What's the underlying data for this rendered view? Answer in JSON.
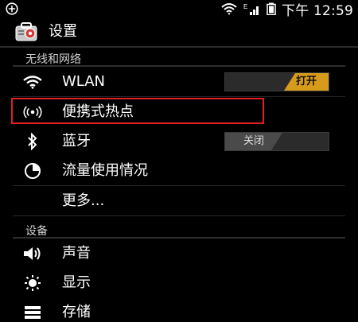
{
  "status_bar": {
    "notification_icon": "plus-circle-icon",
    "signal_icons": [
      "wifi-icon",
      "signal-e-icon",
      "battery-icon"
    ],
    "time": "下午 12:59"
  },
  "app_bar": {
    "icon": "settings-toolbox-icon",
    "title": "设置"
  },
  "sections": {
    "wireless": {
      "title": "无线和网络"
    },
    "device": {
      "title": "设备"
    }
  },
  "rows": {
    "wlan": {
      "label": "WLAN",
      "icon": "wifi-icon",
      "toggle_label": "打开"
    },
    "hotspot": {
      "label": "便携式热点",
      "icon": "hotspot-icon"
    },
    "bluetooth": {
      "label": "蓝牙",
      "icon": "bluetooth-icon",
      "toggle_label": "关闭"
    },
    "data_usage": {
      "label": "流量使用情况",
      "icon": "data-usage-icon"
    },
    "more": {
      "label": "更多..."
    },
    "sound": {
      "label": "声音",
      "icon": "volume-icon"
    },
    "display": {
      "label": "显示",
      "icon": "brightness-icon"
    },
    "storage": {
      "label": "存储",
      "icon": "storage-icon"
    }
  },
  "colors": {
    "background": "#000000",
    "accent_toggle_on": "#d79b1c",
    "highlight": "#e02020"
  }
}
